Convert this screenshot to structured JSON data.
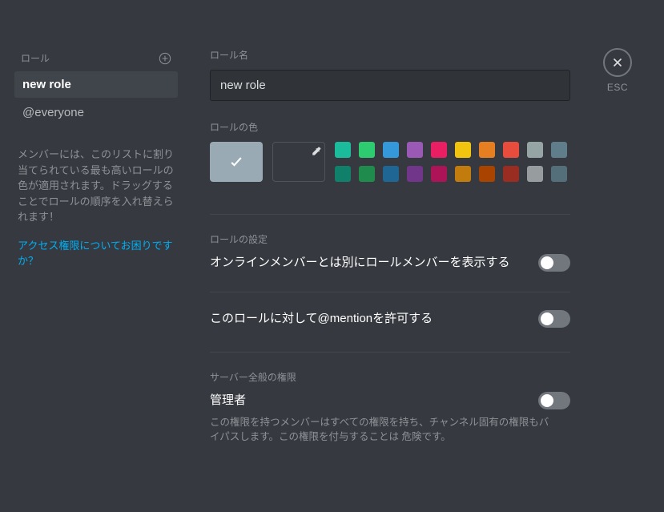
{
  "sidebar": {
    "header": "ロール",
    "roles": [
      {
        "label": "new role",
        "selected": true
      },
      {
        "label": "@everyone",
        "selected": false
      }
    ],
    "note": "メンバーには、このリストに割り当てられている最も高いロールの色が適用されます。ドラッグすることでロールの順序を入れ替えられます！",
    "help_link": "アクセス権限についてお困りですか？"
  },
  "main": {
    "role_name_label": "ロール名",
    "role_name_value": "new role",
    "role_color_label": "ロールの色",
    "colors": [
      "#1abc9c",
      "#2ecc71",
      "#3498db",
      "#9b59b6",
      "#e91e63",
      "#f1c40f",
      "#e67e22",
      "#e74c3c",
      "#95a5a6",
      "#607d8b",
      "#11806a",
      "#1f8b4c",
      "#206694",
      "#71368a",
      "#ad1457",
      "#c27c0e",
      "#a84300",
      "#992d22",
      "#979c9f",
      "#546e7a"
    ],
    "role_settings_label": "ロールの設定",
    "settings": [
      {
        "title": "オンラインメンバーとは別にロールメンバーを表示する",
        "desc": ""
      },
      {
        "title": "このロールに対して@mentionを許可する",
        "desc": ""
      }
    ],
    "general_perms_label": "サーバー全般の権限",
    "perms": [
      {
        "title": "管理者",
        "desc": "この権限を持つメンバーはすべての権限を持ち、チャンネル固有の権限もバイパスします。この権限を付与することは 危険です。"
      }
    ]
  },
  "close_label": "ESC"
}
